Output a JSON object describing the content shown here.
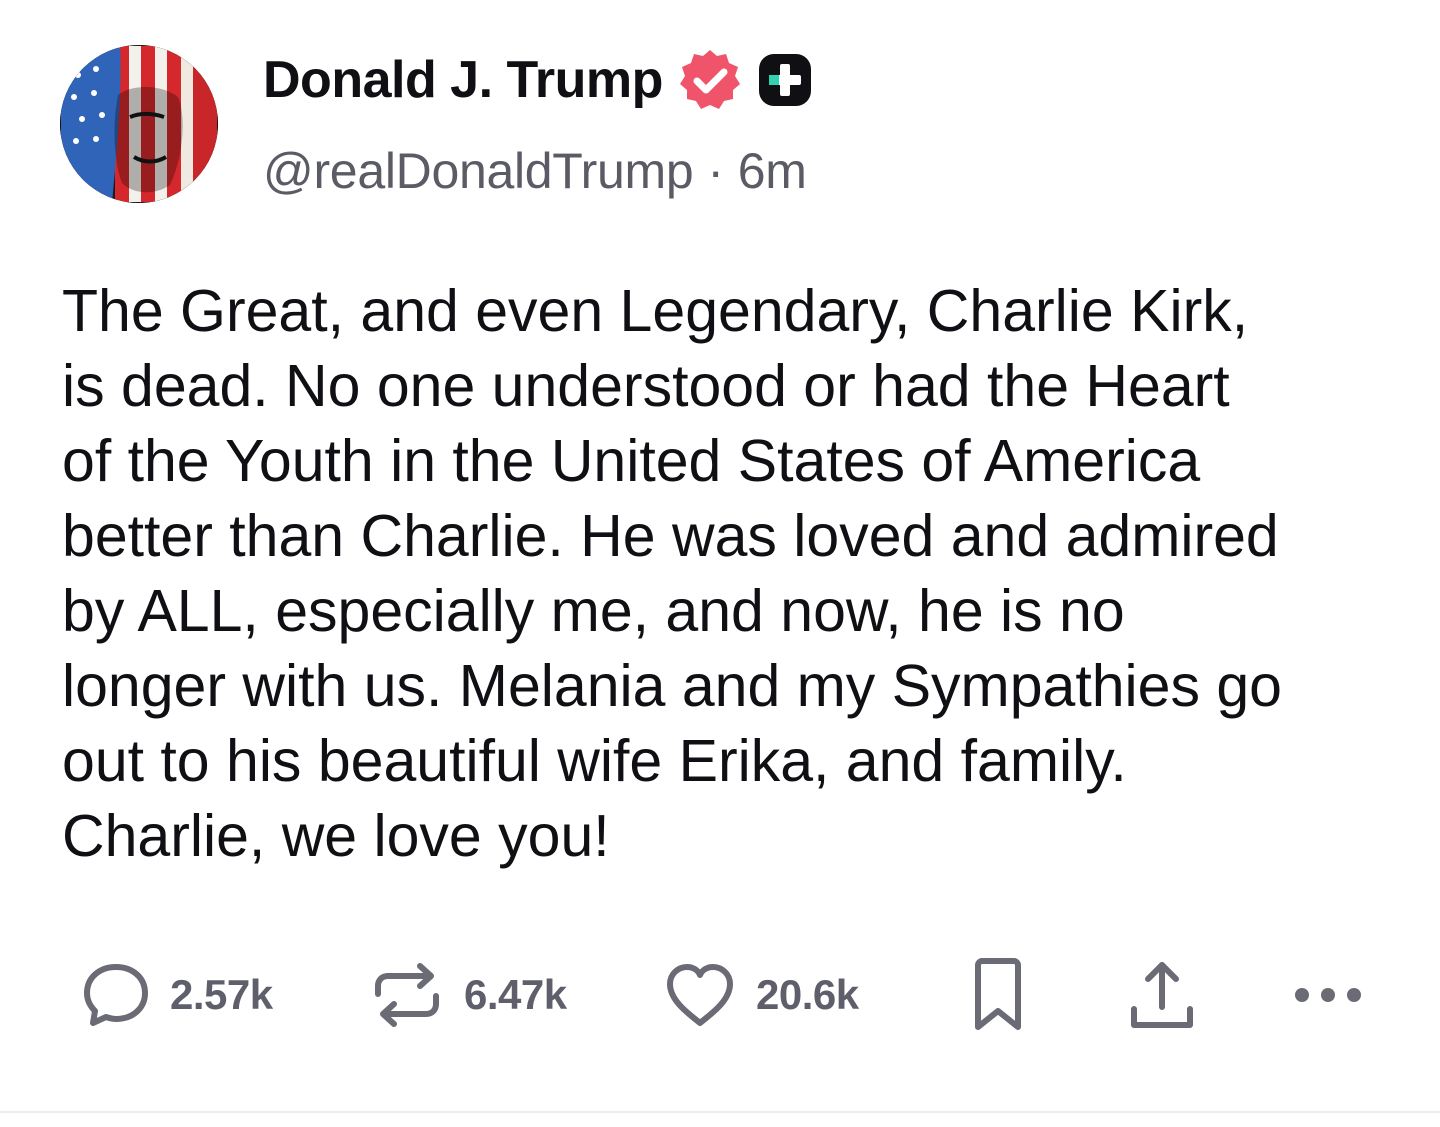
{
  "post": {
    "author": {
      "display_name": "Donald J. Trump",
      "handle": "@realDonaldTrump",
      "verified_icon": "verified-badge-icon",
      "extra_badge_icon": "plus-badge-icon",
      "verified_color": "#f0546b"
    },
    "timestamp_separator": "·",
    "timestamp": "6m",
    "body_lines": [
      "The Great, and even Legendary, Charlie Kirk,",
      "is dead. No one understood or had the Heart",
      "of the Youth in the United States of America",
      "better than Charlie. He was loved and admired",
      "by ALL, especially me, and now, he is no",
      "longer with us. Melania and my Sympathies go",
      "out to his beautiful wife Erika, and family.",
      "Charlie, we love you!"
    ],
    "actions": {
      "replies": "2.57k",
      "reposts": "6.47k",
      "likes": "20.6k"
    },
    "icon_color": "#6b6b76"
  }
}
